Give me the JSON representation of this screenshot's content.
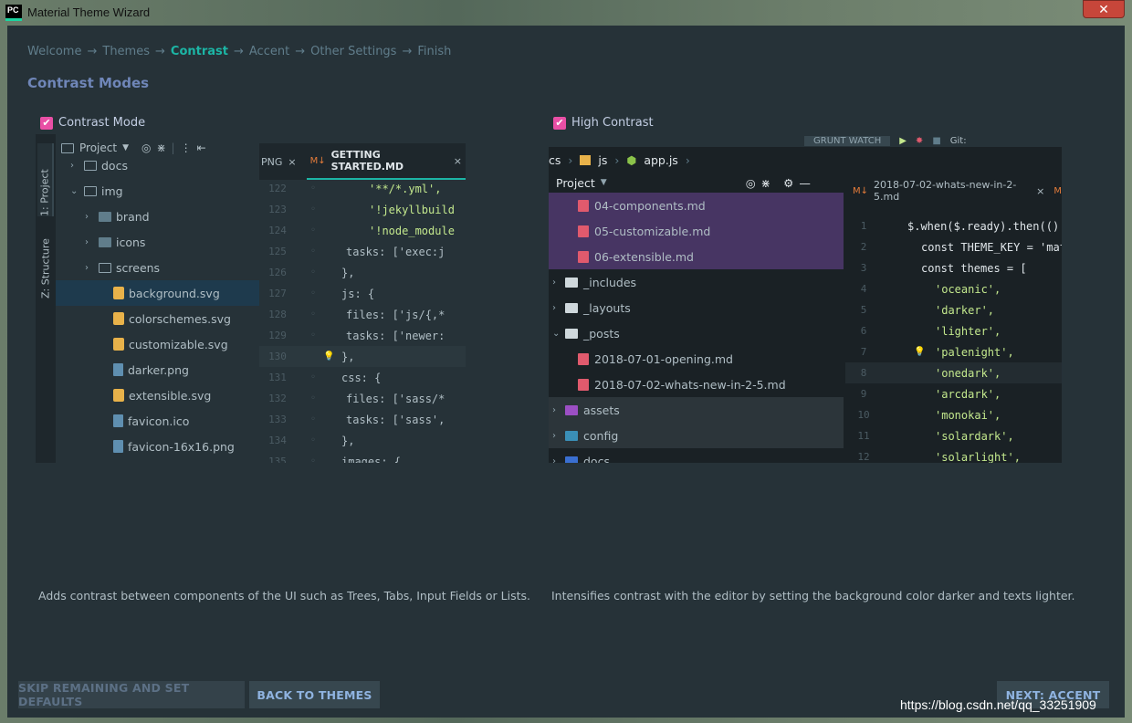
{
  "window": {
    "app_icon_text": "PC",
    "title": "Material Theme Wizard",
    "close_glyph": "✕"
  },
  "breadcrumb": {
    "steps": [
      "Welcome",
      "Themes",
      "Contrast",
      "Accent",
      "Other Settings",
      "Finish"
    ],
    "separator": "→",
    "active_step": "Contrast"
  },
  "heading": "Contrast Modes",
  "options": [
    {
      "label": "Contrast Mode",
      "checked": true,
      "description": "Adds contrast between components of the UI such as Trees, Tabs, Input Fields or Lists."
    },
    {
      "label": "High Contrast",
      "checked": true,
      "description": "Intensifies contrast with the editor by setting the background color darker and texts lighter."
    }
  ],
  "left_preview": {
    "side_tabs": [
      "1: Project",
      "Z: Structure"
    ],
    "tree_header": "Project",
    "tree": [
      {
        "name": "docs",
        "type": "folder",
        "indent": 1,
        "chevron": "›"
      },
      {
        "name": "img",
        "type": "folder-open",
        "indent": 1,
        "chevron": "⌄"
      },
      {
        "name": "brand",
        "type": "folder-filled",
        "indent": 2,
        "chevron": "›"
      },
      {
        "name": "icons",
        "type": "folder-filled",
        "indent": 2,
        "chevron": "›"
      },
      {
        "name": "screens",
        "type": "folder",
        "indent": 2,
        "chevron": "›"
      },
      {
        "name": "background.svg",
        "type": "svg",
        "indent": 3,
        "selected": true
      },
      {
        "name": "colorschemes.svg",
        "type": "svg",
        "indent": 3
      },
      {
        "name": "customizable.svg",
        "type": "svg",
        "indent": 3
      },
      {
        "name": "darker.png",
        "type": "png",
        "indent": 3
      },
      {
        "name": "extensible.svg",
        "type": "svg",
        "indent": 3
      },
      {
        "name": "favicon.ico",
        "type": "png",
        "indent": 3
      },
      {
        "name": "favicon-16x16.png",
        "type": "png",
        "indent": 3
      }
    ],
    "tabs": [
      {
        "label": "PNG",
        "close": "×"
      },
      {
        "label": "GETTING STARTED.MD",
        "close": "×"
      }
    ],
    "code": [
      {
        "ln": "122",
        "text": "'**/*.yml',"
      },
      {
        "ln": "123",
        "text": "'!jekyllbuild"
      },
      {
        "ln": "124",
        "text": "'!node_module"
      },
      {
        "ln": "125",
        "text": "tasks: ['exec:j"
      },
      {
        "ln": "126",
        "text": "},"
      },
      {
        "ln": "127",
        "text": "js: {"
      },
      {
        "ln": "128",
        "text": "files: ['js/{,*"
      },
      {
        "ln": "129",
        "text": "tasks: ['newer:"
      },
      {
        "ln": "130",
        "text": "},"
      },
      {
        "ln": "131",
        "text": "css: {"
      },
      {
        "ln": "132",
        "text": "files: ['sass/*"
      },
      {
        "ln": "133",
        "text": "tasks: ['sass',"
      },
      {
        "ln": "134",
        "text": "},"
      },
      {
        "ln": "135",
        "text": "images: {"
      }
    ]
  },
  "right_preview": {
    "toolbar_label": "GRUNT WATCH",
    "toolbar_git": "Git:",
    "path": [
      "cs",
      "js",
      "app.js"
    ],
    "tree_header": "Project",
    "tree": [
      {
        "name": "04-components.md",
        "type": "md",
        "style": "purple"
      },
      {
        "name": "05-customizable.md",
        "type": "md",
        "style": "purple"
      },
      {
        "name": "06-extensible.md",
        "type": "md",
        "style": "purple"
      },
      {
        "name": "_includes",
        "type": "folder",
        "chevron": "›"
      },
      {
        "name": "_layouts",
        "type": "folder",
        "chevron": "›"
      },
      {
        "name": "_posts",
        "type": "folder-open",
        "chevron": "⌄"
      },
      {
        "name": "2018-07-01-opening.md",
        "type": "md"
      },
      {
        "name": "2018-07-02-whats-new-in-2-5.md",
        "type": "md"
      },
      {
        "name": "assets",
        "type": "folder-special",
        "chevron": "›",
        "style": "dark"
      },
      {
        "name": "config",
        "type": "folder-special",
        "chevron": "›",
        "style": "dark"
      },
      {
        "name": "docs",
        "type": "folder-special",
        "chevron": "›"
      }
    ],
    "tab": {
      "label": "2018-07-02-whats-new-in-2-5.md",
      "close": "×"
    },
    "code": [
      {
        "ln": "1",
        "text": "$.when($.ready).then(()"
      },
      {
        "ln": "2",
        "text": "const THEME_KEY = 'mat"
      },
      {
        "ln": "3",
        "text": "const themes = ["
      },
      {
        "ln": "4",
        "text": "'oceanic',"
      },
      {
        "ln": "5",
        "text": "'darker',"
      },
      {
        "ln": "6",
        "text": "'lighter',"
      },
      {
        "ln": "7",
        "text": "'palenight',"
      },
      {
        "ln": "8",
        "text": "'onedark',"
      },
      {
        "ln": "9",
        "text": "'arcdark',"
      },
      {
        "ln": "10",
        "text": "'monokai',"
      },
      {
        "ln": "11",
        "text": "'solardark',"
      },
      {
        "ln": "12",
        "text": "'solarlight',"
      }
    ]
  },
  "buttons": {
    "skip": "SKIP REMAINING AND SET DEFAULTS",
    "back": "BACK TO THEMES",
    "next": "NEXT: ACCENT"
  },
  "watermark": "https://blog.csdn.net/qq_33251909",
  "colors": {
    "background": "#263238",
    "accent_teal": "#1cb5a5",
    "checkbox_pink": "#e94fa5",
    "heading": "#6f86b8",
    "string_green": "#c3e88d",
    "purple_selection": "#473563"
  }
}
